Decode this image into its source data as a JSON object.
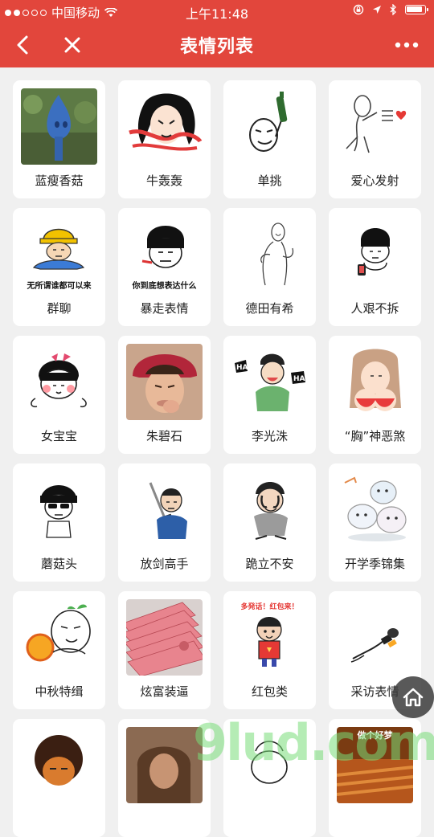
{
  "status_bar": {
    "carrier": "中国移动",
    "time": "上午11:48"
  },
  "nav": {
    "title": "表情列表"
  },
  "items": [
    {
      "label": "蓝瘦香菇"
    },
    {
      "label": "牛轰轰"
    },
    {
      "label": "单挑"
    },
    {
      "label": "爱心发射"
    },
    {
      "label": "群聊",
      "caption": "无所谓谁都可以来"
    },
    {
      "label": "暴走表情",
      "caption": "你到底想表达什么"
    },
    {
      "label": "德田有希"
    },
    {
      "label": "人艰不拆"
    },
    {
      "label": "女宝宝"
    },
    {
      "label": "朱碧石"
    },
    {
      "label": "李光洙"
    },
    {
      "label": "“胸”神恶煞"
    },
    {
      "label": "蘑菇头"
    },
    {
      "label": "放剑高手"
    },
    {
      "label": "跪立不安"
    },
    {
      "label": "开学季锦集"
    },
    {
      "label": "中秋特缉"
    },
    {
      "label": "炫富装逼"
    },
    {
      "label": "红包类",
      "caption": "多発话！红包来！"
    },
    {
      "label": "采访表情"
    }
  ],
  "partial_row": {
    "item2_caption": "",
    "item4_caption": "做个好梦"
  },
  "watermark": "9lud.com"
}
